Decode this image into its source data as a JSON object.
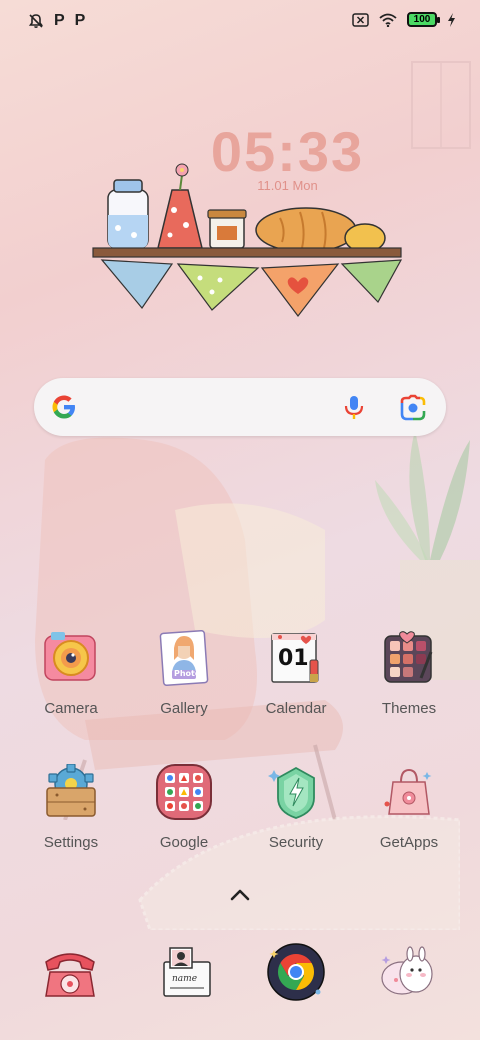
{
  "status_bar": {
    "left_icons": [
      "notifications-off-icon",
      "p-icon",
      "p-icon"
    ],
    "p_label": "P",
    "right_icons": [
      "sim-off-icon",
      "wifi-icon",
      "battery-icon",
      "charging-icon"
    ],
    "battery_level": "100"
  },
  "clock": {
    "time": "05:33",
    "date": "11.01 Mon"
  },
  "search": {
    "icons": [
      "google-logo-icon",
      "mic-icon",
      "lens-icon"
    ]
  },
  "apps": [
    {
      "label": "Camera",
      "icon": "camera-icon"
    },
    {
      "label": "Gallery",
      "icon": "gallery-icon"
    },
    {
      "label": "Calendar",
      "icon": "calendar-icon",
      "day": "01"
    },
    {
      "label": "Themes",
      "icon": "themes-icon"
    },
    {
      "label": "Settings",
      "icon": "settings-icon"
    },
    {
      "label": "Google",
      "icon": "google-folder-icon"
    },
    {
      "label": "Security",
      "icon": "security-icon"
    },
    {
      "label": "GetApps",
      "icon": "getapps-icon"
    }
  ],
  "gallery_sticker_text": "Photo",
  "notes_sticker_text": "name",
  "dock": [
    {
      "icon": "phone-icon"
    },
    {
      "icon": "messages-icon"
    },
    {
      "icon": "chrome-icon"
    },
    {
      "icon": "contacts-icon"
    }
  ],
  "colors": {
    "clock": "#e8a59c",
    "accent_green": "#4cd964"
  }
}
